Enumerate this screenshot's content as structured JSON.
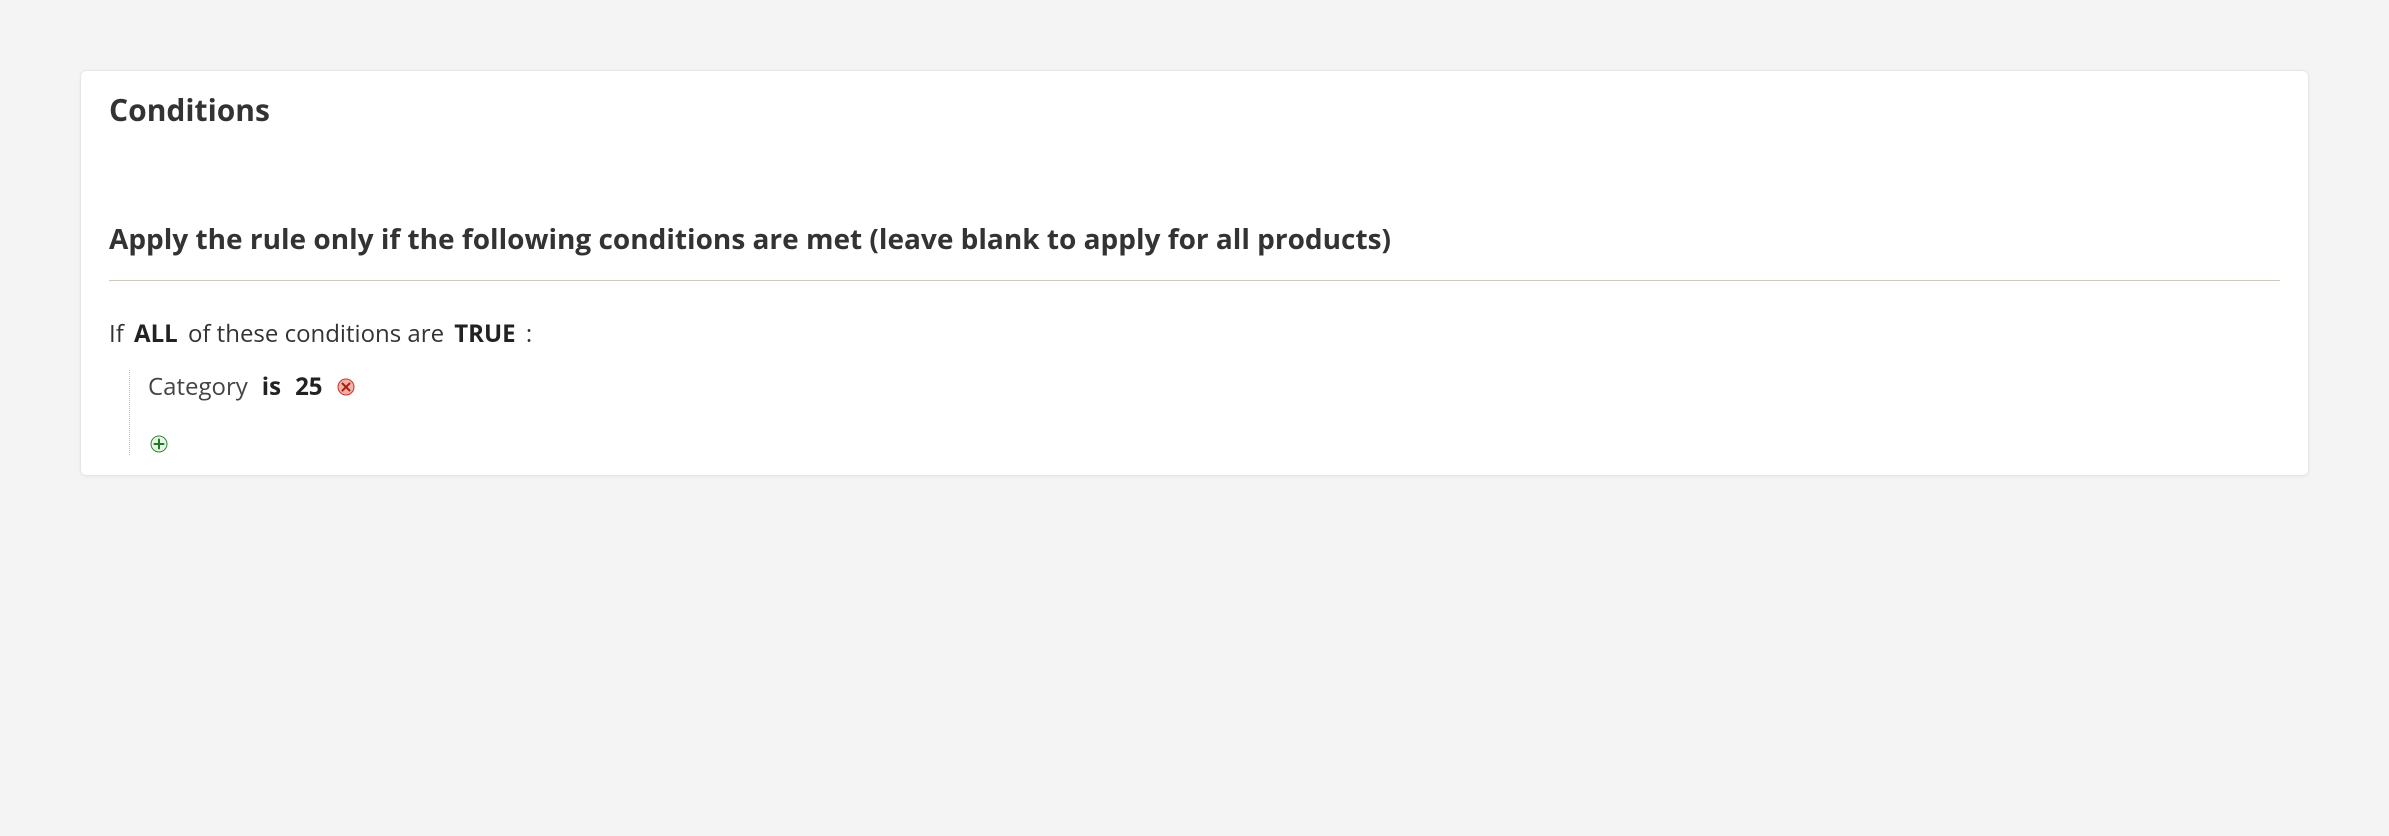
{
  "panel": {
    "title": "Conditions"
  },
  "section": {
    "heading": "Apply the rule only if the following conditions are met (leave blank to apply for all products)"
  },
  "root": {
    "prefix": "If",
    "aggregator": "ALL",
    "middle": "of these conditions are",
    "value": "TRUE",
    "suffix": ":"
  },
  "conditions": [
    {
      "attribute": "Category",
      "operator": "is",
      "value": "25"
    }
  ]
}
